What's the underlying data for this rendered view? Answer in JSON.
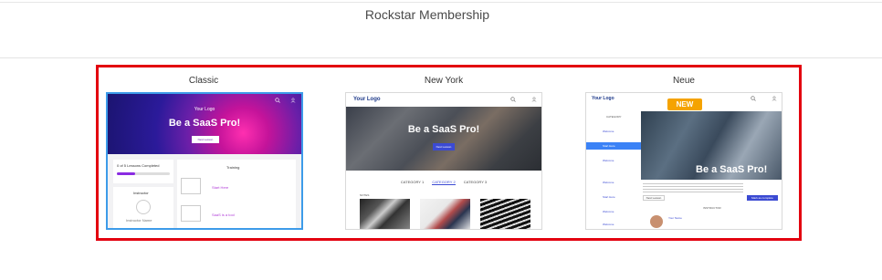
{
  "page": {
    "title": "Rockstar Membership"
  },
  "templates": [
    {
      "name": "Classic",
      "selected": true,
      "preview": {
        "logo": "Your Logo",
        "nav_text": "Library",
        "hero_title": "Be a SaaS Pro!",
        "button_label": "Next Lesson",
        "progress_text": "0 of 5 Lessons Completed",
        "progress_value": 0.35,
        "instructor_heading": "Instructor",
        "instructor_name": "Instructor Name",
        "training_heading": "Training",
        "lesson_links": [
          "Start Here",
          "SaaS is a tool"
        ]
      }
    },
    {
      "name": "New York",
      "selected": false,
      "preview": {
        "logo": "Your Logo",
        "hero_title": "Be a SaaS Pro!",
        "button_label": "Next Lesson",
        "tabs": [
          "CATEGORY 1",
          "CATEGORY 2",
          "CATEGORY 3"
        ],
        "active_tab": "CATEGORY 2",
        "section_label": "NOTES"
      }
    },
    {
      "name": "Neue",
      "selected": false,
      "preview": {
        "logo": "Your Logo",
        "badge": "NEW",
        "hero_title": "Be a SaaS Pro!",
        "sidebar_heading": "CATEGORY",
        "sidebar_items": [
          "Welcome",
          "Start Here",
          "Welcome",
          "Welcome",
          "Start Here",
          "Welcome",
          "Welcome",
          "Welcome"
        ],
        "active_item": "Start Here",
        "left_button": "Next Lesson",
        "right_button": "Mark as complete",
        "instructor_heading": "INSTRUCTOR",
        "instructor_name": "Your Name"
      }
    }
  ],
  "colors": {
    "highlight": "#e3000f",
    "selected_border": "#3d9be9",
    "accent": "#3b4ad3",
    "badge": "#f5a300"
  }
}
